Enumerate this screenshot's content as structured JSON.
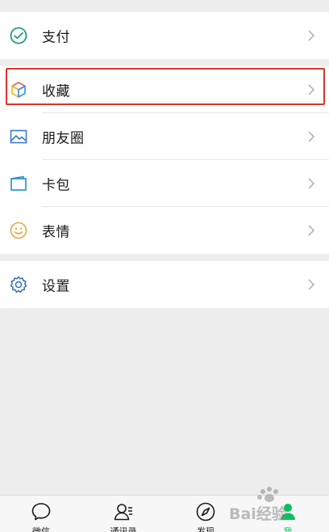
{
  "menu": {
    "pay": "支付",
    "favorites": "收藏",
    "moments": "朋友圈",
    "cards": "卡包",
    "stickers": "表情",
    "settings": "设置"
  },
  "tabbar": {
    "chats": "微信",
    "contacts": "通讯录",
    "discover": "发现",
    "me": "我",
    "active": "me"
  },
  "colors": {
    "highlight": "#d9352b",
    "accent": "#07c160",
    "background": "#ededed"
  },
  "watermark": "Bai经验"
}
